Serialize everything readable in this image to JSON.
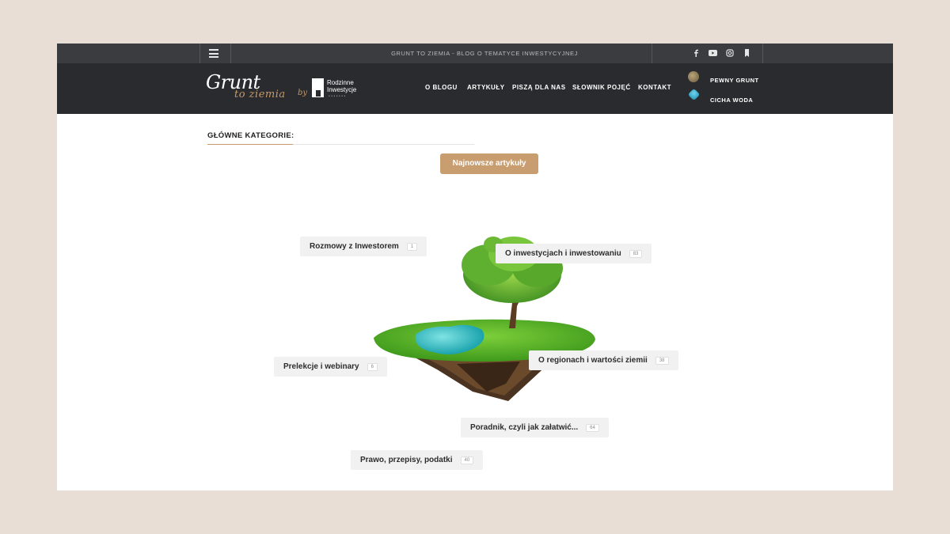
{
  "topbar": {
    "tagline": "GRUNT TO ZIEMIA - BLOG O TEMATYCE INWESTYCYJNEJ",
    "menu_icon": "hamburger-icon",
    "social": [
      "facebook-icon",
      "youtube-icon",
      "instagram-icon",
      "bookmark-icon"
    ]
  },
  "header": {
    "logo_line1": "Grunt",
    "logo_line2": "to ziemia",
    "logo_by": "by",
    "partner_logo_line1": "Rodzinne",
    "partner_logo_line2": "Inwestycje",
    "nav": [
      "O BLOGU",
      "ARTYKUŁY",
      "PISZĄ DLA NAS",
      "SŁOWNIK POJĘĆ",
      "KONTAKT"
    ],
    "partners": [
      {
        "label": "PEWNY GRUNT",
        "color": "#8a7a5a"
      },
      {
        "label": "CICHA WODA",
        "color": "#2aa7c9"
      }
    ]
  },
  "main": {
    "section_title": "GŁÓWNE KATEGORIE:",
    "cta_label": "Najnowsze artykuły",
    "categories": [
      {
        "label": "Rozmowy z Inwestorem",
        "count": "1"
      },
      {
        "label": "O inwestycjach i inwestowaniu",
        "count": "83"
      },
      {
        "label": "Prelekcje i webinary",
        "count": "6"
      },
      {
        "label": "O regionach i wartości ziemii",
        "count": "38"
      },
      {
        "label": "Poradnik, czyli jak załatwić...",
        "count": "64"
      },
      {
        "label": "Prawo, przepisy, podatki",
        "count": "40"
      }
    ]
  },
  "colors": {
    "accent": "#c89d70",
    "header_bg": "#2a2b2e",
    "topbar_bg": "#3a3c40",
    "page_bg": "#e8ded5"
  }
}
